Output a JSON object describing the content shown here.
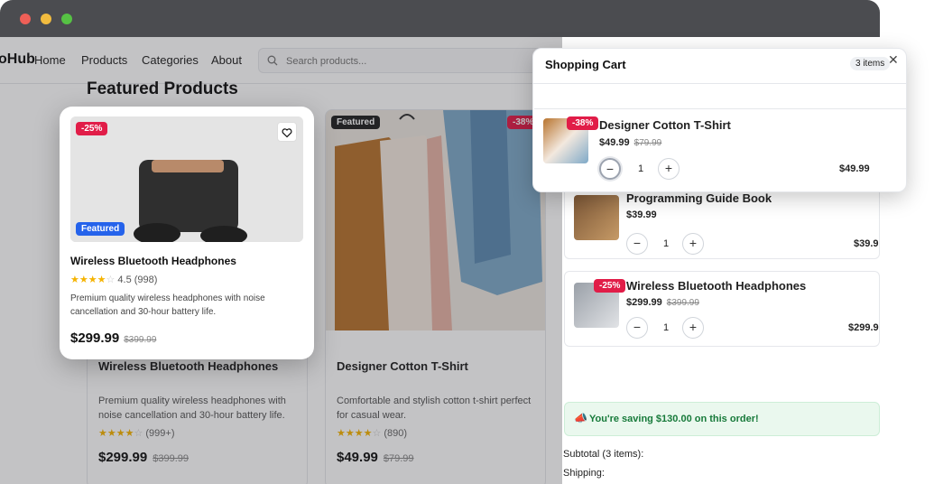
{
  "nav": {
    "brand": "oHub",
    "links": [
      "Home",
      "Products",
      "Categories",
      "About"
    ],
    "search_placeholder": "Search products..."
  },
  "section_title": "Featured Products",
  "bg_cards": [
    {
      "title": "Wireless Bluetooth Headphones",
      "description": "Premium quality wireless headphones with noise cancellation and 30-hour battery life.",
      "rating_count": "(999+)",
      "price": "$299.99",
      "old_price": "$399.99"
    },
    {
      "badge": "Featured",
      "discount": "-38%",
      "title": "Designer Cotton T-Shirt",
      "description": "Comfortable and stylish cotton t-shirt perfect for casual wear.",
      "rating_count": "(890)",
      "price": "$49.99",
      "old_price": "$79.99"
    }
  ],
  "product_popup": {
    "discount": "-25%",
    "badge": "Featured",
    "title": "Wireless Bluetooth Headphones",
    "rating": "4.5 (998)",
    "description": "Premium quality wireless headphones with noise cancellation and 30-hour battery life.",
    "price": "$299.99",
    "old_price": "$399.99"
  },
  "cart_popup": {
    "title": "Shopping Cart",
    "count": "3 items",
    "close_symbol": "✕",
    "item": {
      "discount": "-38%",
      "name": "Designer Cotton T-Shirt",
      "price": "$49.99",
      "old_price": "$79.99",
      "qty": "1",
      "total": "$49.99"
    }
  },
  "cart_items": [
    {
      "name": "Programming Guide Book",
      "price": "$39.99",
      "qty": "1",
      "total": "$39.9"
    },
    {
      "discount": "-25%",
      "name": "Wireless Bluetooth Headphones",
      "price": "$299.99",
      "old_price": "$399.99",
      "qty": "1",
      "total": "$299.9"
    }
  ],
  "saving_text": "You're saving $130.00 on this order!",
  "subtotal_label": "Subtotal (3 items):",
  "shipping_label": "Shipping:",
  "colors": {
    "discount_red": "#e11d48",
    "featured_blue": "#2563eb",
    "saving_green": "#177a3a"
  }
}
